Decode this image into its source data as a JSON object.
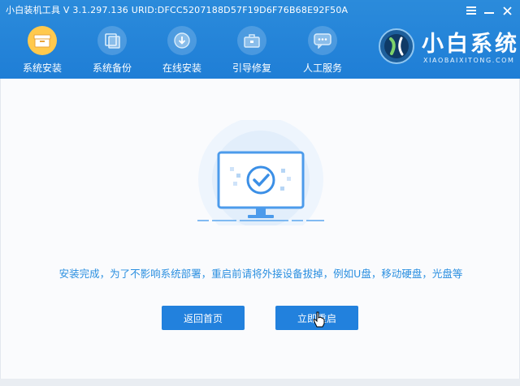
{
  "app": {
    "title": "小白装机工具 V 3.1.297.136 URID:DFCC5207188D57F19D6F76B68E92F50A"
  },
  "nav": {
    "items": [
      {
        "label": "系统安装",
        "icon": "box-icon",
        "active": true
      },
      {
        "label": "系统备份",
        "icon": "backup-icon",
        "active": false
      },
      {
        "label": "在线安装",
        "icon": "download-icon",
        "active": false
      },
      {
        "label": "引导修复",
        "icon": "toolbox-icon",
        "active": false
      },
      {
        "label": "人工服务",
        "icon": "chat-icon",
        "active": false
      }
    ]
  },
  "logo": {
    "name": "小白系统",
    "subtitle": "XIAOBAIXITONG.COM"
  },
  "main": {
    "message": "安装完成，为了不影响系统部署，重启前请将外接设备拔掉，例如U盘，移动硬盘，光盘等",
    "back_label": "返回首页",
    "reboot_label": "立即重启"
  },
  "colors": {
    "header": "#1f7ed6",
    "accent": "#2281dd",
    "active_tab": "#ffc94d",
    "message": "#2a8fe0"
  }
}
